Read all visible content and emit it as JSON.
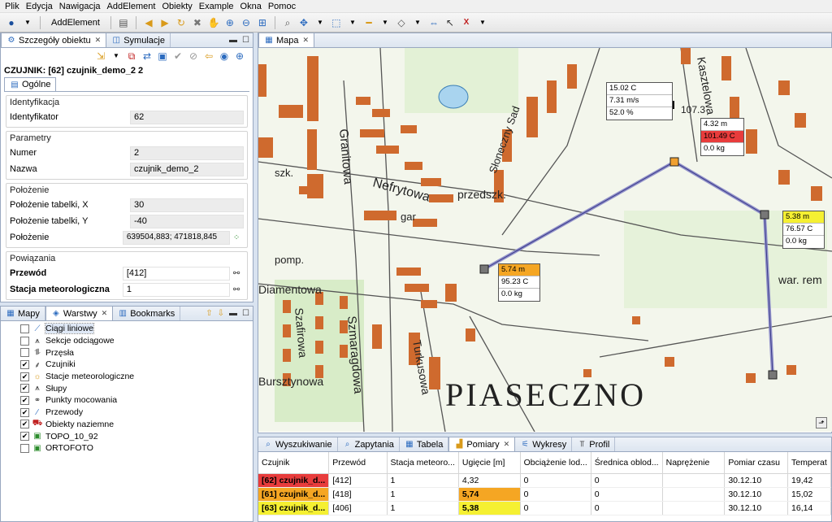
{
  "menu": [
    "Plik",
    "Edycja",
    "Nawigacja",
    "AddElement",
    "Obiekty",
    "Example",
    "Okna",
    "Pomoc"
  ],
  "toolbar": {
    "add_element_label": "AddElement"
  },
  "details": {
    "tabs": [
      {
        "label": "Szczegóły obiektu"
      },
      {
        "label": "Symulacje"
      }
    ],
    "title": "CZUJNIK: [62] czujnik_demo_2 2",
    "inner_tab": "Ogólne",
    "groups": {
      "identyfikacja": {
        "title": "Identyfikacja",
        "id_label": "Identyfikator",
        "id_value": "62"
      },
      "parametry": {
        "title": "Parametry",
        "numer_label": "Numer",
        "numer_value": "2",
        "nazwa_label": "Nazwa",
        "nazwa_value": "czujnik_demo_2"
      },
      "polozenie": {
        "title": "Położenie",
        "x_label": "Położenie tabelki, X",
        "x_value": "30",
        "y_label": "Położenie tabelki, Y",
        "y_value": "-40",
        "pos_label": "Położenie",
        "pos_value": "639504,883; 471818,845"
      },
      "powiazania": {
        "title": "Powiązania",
        "przewod_label": "Przewód",
        "przewod_value": "[412]",
        "stacja_label": "Stacja meteorologiczna",
        "stacja_value": "1"
      }
    }
  },
  "layers_panel": {
    "tabs": [
      {
        "label": "Mapy"
      },
      {
        "label": "Warstwy"
      },
      {
        "label": "Bookmarks"
      }
    ],
    "layers": [
      {
        "label": "Ciągi liniowe",
        "checked": false,
        "icon": "line-icon"
      },
      {
        "label": "Sekcje odciągowe",
        "checked": false,
        "icon": "tower-icon"
      },
      {
        "label": "Przęsła",
        "checked": false,
        "icon": "span-icon"
      },
      {
        "label": "Czujniki",
        "checked": true,
        "icon": "sensor-icon"
      },
      {
        "label": "Stacje meteorologiczne",
        "checked": true,
        "icon": "weather-station-icon"
      },
      {
        "label": "Słupy",
        "checked": true,
        "icon": "pole-icon"
      },
      {
        "label": "Punkty mocowania",
        "checked": true,
        "icon": "mount-point-icon"
      },
      {
        "label": "Przewody",
        "checked": true,
        "icon": "wire-icon"
      },
      {
        "label": "Obiekty naziemne",
        "checked": true,
        "icon": "ground-object-icon"
      },
      {
        "label": "TOPO_10_92",
        "checked": true,
        "icon": "raster-icon"
      },
      {
        "label": "ORTOFOTO",
        "checked": false,
        "icon": "raster-icon"
      }
    ]
  },
  "map": {
    "tab_label": "Mapa",
    "town_label": "PIASECZNO",
    "street_labels": [
      "Nefrytowa",
      "przedszk.",
      "Granitowa",
      "Szmaragdowa",
      "Turkusowa",
      "Szafirowa",
      "Słoneczny Sad",
      "Kasztelowa",
      "pomp.",
      "szk.",
      "gar",
      "war. rem",
      "Diamentowa",
      "Bursztynowa",
      "107.3"
    ],
    "weather_label": [
      "15.02 C",
      "7.31 m/s",
      "52.0 %"
    ],
    "sensor_labels": [
      {
        "rows": [
          "4.32 m",
          "101.49 C",
          "0.0 kg"
        ],
        "highlight_row": 1,
        "color": "#e83c3c"
      },
      {
        "rows": [
          "5.38 m",
          "76.57 C",
          "0.0 kg"
        ],
        "highlight_row": 0,
        "color": "#f5f032"
      },
      {
        "rows": [
          "5.74 m",
          "95.23 C",
          "0.0 kg"
        ],
        "highlight_row": 0,
        "color": "#f5a623"
      }
    ]
  },
  "bottom": {
    "tabs": [
      {
        "label": "Wyszukiwanie"
      },
      {
        "label": "Zapytania"
      },
      {
        "label": "Tabela"
      },
      {
        "label": "Pomiary"
      },
      {
        "label": "Wykresy"
      },
      {
        "label": "Profil"
      }
    ],
    "columns": [
      "Czujnik",
      "Przewód",
      "Stacja meteoro...",
      "Ugięcie [m]",
      "Obciążenie lod...",
      "Średnica oblod...",
      "Naprężenie",
      "Pomiar czasu",
      "Temperat"
    ],
    "rows": [
      {
        "cells": [
          "[62] czujnik_d...",
          "[412]",
          "1",
          "4,32",
          "0",
          "0",
          "",
          "30.12.10",
          "19,42"
        ],
        "color": "#e83c3c",
        "highlight_deflection": false
      },
      {
        "cells": [
          "[61] czujnik_d...",
          "[418]",
          "1",
          "5,74",
          "0",
          "0",
          "",
          "30.12.10",
          "15,02"
        ],
        "color": "#f5a623",
        "highlight_deflection": true
      },
      {
        "cells": [
          "[63] czujnik_d...",
          "[406]",
          "1",
          "5,38",
          "0",
          "0",
          "",
          "30.12.10",
          "16,14"
        ],
        "color": "#f5f032",
        "highlight_deflection": true
      }
    ]
  }
}
